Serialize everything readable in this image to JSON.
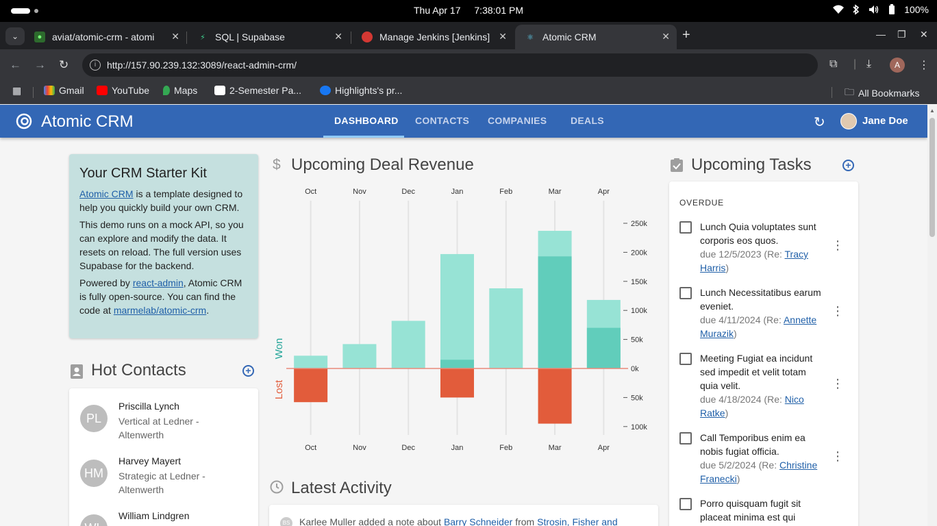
{
  "os": {
    "date": "Thu Apr 17",
    "time": "7:38:01 PM",
    "battery": "100%"
  },
  "browser": {
    "tabs": [
      {
        "title": "aviat/atomic-crm - atomi",
        "icon": "github-icon"
      },
      {
        "title": "SQL | Supabase",
        "icon": "supabase-icon"
      },
      {
        "title": "Manage Jenkins [Jenkins]",
        "icon": "jenkins-icon"
      },
      {
        "title": "Atomic CRM",
        "icon": "react-icon"
      }
    ],
    "url": "http://157.90.239.132:3089/react-admin-crm/",
    "profile_initial": "A",
    "bookmarks": [
      "Gmail",
      "YouTube",
      "Maps",
      "2-Semester Pa...",
      "Highlights's pr..."
    ],
    "all_bookmarks": "All Bookmarks"
  },
  "app": {
    "brand": "Atomic CRM",
    "nav": [
      "DASHBOARD",
      "CONTACTS",
      "COMPANIES",
      "DEALS"
    ],
    "user": "Jane Doe"
  },
  "kit": {
    "title": "Your CRM Starter Kit",
    "p1_link": "Atomic CRM",
    "p1_text": " is a template designed to help you quickly build your own CRM.",
    "p2": "This demo runs on a mock API, so you can explore and modify the data. It resets on reload. The full version uses Supabase for the backend.",
    "p3_a": "Powered by ",
    "p3_link1": "react-admin",
    "p3_b": ", Atomic CRM is fully open-source. You can find the code at ",
    "p3_link2": "marmelab/atomic-crm",
    "p3_c": "."
  },
  "hot_contacts": {
    "title": "Hot Contacts",
    "items": [
      {
        "initials": "PL",
        "name": "Priscilla Lynch",
        "sub": "Vertical at Ledner - Altenwerth"
      },
      {
        "initials": "HM",
        "name": "Harvey Mayert",
        "sub": "Strategic at Ledner - Altenwerth"
      },
      {
        "initials": "WL",
        "name": "William Lindgren",
        "sub": ""
      }
    ]
  },
  "revenue": {
    "title": "Upcoming Deal Revenue",
    "won_label": "Won",
    "lost_label": "Lost"
  },
  "chart_data": {
    "type": "bar",
    "categories": [
      "Oct",
      "Nov",
      "Dec",
      "Jan",
      "Feb",
      "Mar",
      "Apr"
    ],
    "series": [
      {
        "name": "Won",
        "values": [
          0,
          0,
          0,
          15000,
          0,
          193000,
          70000
        ],
        "color": "#61cdbb"
      },
      {
        "name": "",
        "values": [
          22000,
          42000,
          82000,
          197000,
          138000,
          237000,
          118000
        ],
        "color": "#97e3d5"
      },
      {
        "name": "Lost",
        "values": [
          -58000,
          0,
          0,
          -50000,
          0,
          -95000,
          0
        ],
        "color": "#e25c3b"
      }
    ],
    "ylim": [
      -110000,
      265000
    ],
    "yticks": [
      250000,
      200000,
      150000,
      100000,
      50000,
      0,
      -50000,
      -100000
    ],
    "ytick_labels": [
      "250k",
      "200k",
      "150k",
      "100k",
      "50k",
      "0k",
      "50k",
      "100k"
    ],
    "xlabel": "",
    "ylabel": ""
  },
  "activity": {
    "title": "Latest Activity",
    "initials": "BS",
    "text_a": "Karlee Muller added a note about ",
    "link1": "Barry Schneider",
    "text_b": " from ",
    "link2": "Strosin, Fisher and"
  },
  "tasks": {
    "title": "Upcoming Tasks",
    "section": "OVERDUE",
    "items": [
      {
        "text": "Lunch Quia voluptates sunt corporis eos quos.",
        "due": "due 12/5/2023 (Re: ",
        "who": "Tracy Harris"
      },
      {
        "text": "Lunch Necessitatibus earum eveniet.",
        "due": "due 4/11/2024 (Re: ",
        "who": "Annette Murazik"
      },
      {
        "text": "Meeting Fugiat ea incidunt sed impedit et velit totam quia velit.",
        "due": "due 4/18/2024 (Re: ",
        "who": "Nico Ratke"
      },
      {
        "text": "Call Temporibus enim ea nobis fugiat officia.",
        "due": "due 5/2/2024 (Re: ",
        "who": "Christine Franecki"
      },
      {
        "text": "Porro quisquam fugit sit placeat minima est qui",
        "due": "",
        "who": ""
      }
    ]
  },
  "colors": {
    "appbar": "#3367b5",
    "kit_bg": "#c5e0df",
    "won": "#61cdbb",
    "won_light": "#97e3d5",
    "lost": "#e25c3b"
  }
}
